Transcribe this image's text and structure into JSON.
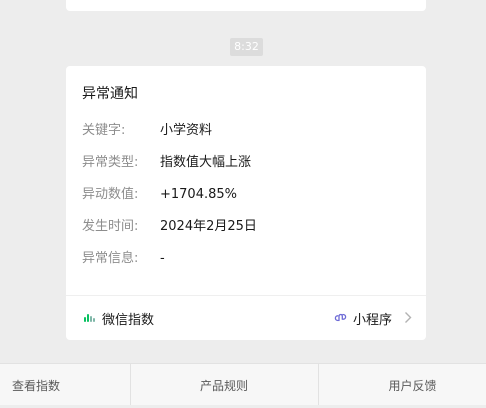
{
  "timestamp": "8:32",
  "card": {
    "title": "异常通知",
    "rows": [
      {
        "label": "关键字:",
        "value": "小学资料"
      },
      {
        "label": "异常类型:",
        "value": "指数值大幅上涨"
      },
      {
        "label": "异动数值:",
        "value": "+1704.85%"
      },
      {
        "label": "发生时间:",
        "value": "2024年2月25日"
      },
      {
        "label": "异常信息:",
        "value": "-"
      }
    ],
    "footer": {
      "brand_icon": "wechat-index-icon",
      "brand_name": "微信指数",
      "mini_program_icon": "mini-program-link-icon",
      "mini_program_label": "小程序",
      "chevron_icon": "chevron-right-icon"
    }
  },
  "bottom_menu": [
    {
      "label": "查看指数"
    },
    {
      "label": "产品规则"
    },
    {
      "label": "用户反馈"
    }
  ],
  "colors": {
    "background": "#ededed",
    "card": "#ffffff",
    "brand_green": "#07c160",
    "muted_text": "#8d8d8d"
  }
}
